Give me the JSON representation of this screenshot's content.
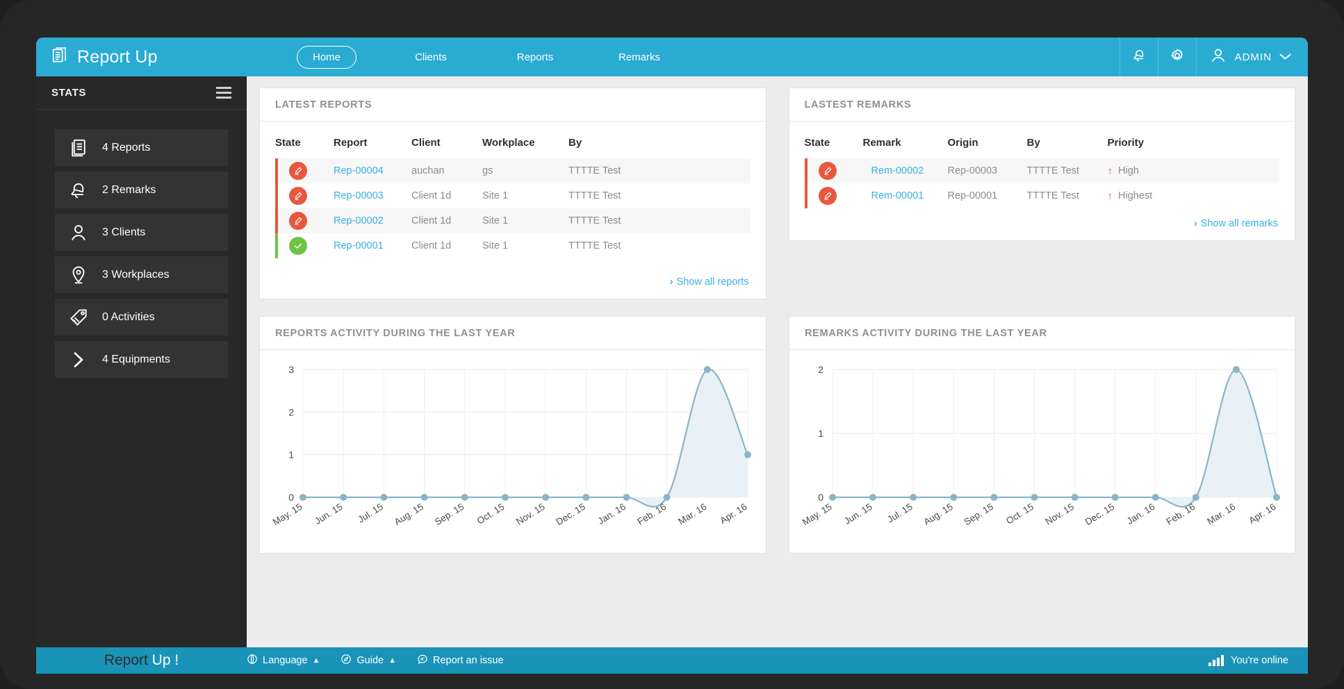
{
  "brand": {
    "title": "Report Up",
    "icon": "document-stack-icon"
  },
  "topnav": {
    "items": [
      {
        "label": "Home",
        "active": true
      },
      {
        "label": "Clients",
        "active": false
      },
      {
        "label": "Reports",
        "active": false
      },
      {
        "label": "Remarks",
        "active": false
      }
    ],
    "icons": [
      {
        "name": "bell-icon"
      },
      {
        "name": "gear-icon"
      }
    ],
    "user": {
      "label": "ADMIN",
      "avatar_icon": "user-icon",
      "caret": "▼"
    }
  },
  "sidebar": {
    "title": "STATS",
    "menu_icon": "hamburger-icon",
    "items": [
      {
        "label": "4 Reports",
        "icon": "document-stack-icon"
      },
      {
        "label": "2 Remarks",
        "icon": "bell-icon"
      },
      {
        "label": "3 Clients",
        "icon": "user-icon"
      },
      {
        "label": "3 Workplaces",
        "icon": "map-pin-icon"
      },
      {
        "label": "0 Activities",
        "icon": "tag-icon"
      },
      {
        "label": "4 Equipments",
        "icon": "chevron-right-icon"
      }
    ]
  },
  "latest_reports": {
    "title": "LATEST REPORTS",
    "columns": [
      "State",
      "Report",
      "Client",
      "Workplace",
      "By"
    ],
    "rows": [
      {
        "state": "pending",
        "report": "Rep-00004",
        "client": "auchan",
        "workplace": "gs",
        "by": "TTTTE Test"
      },
      {
        "state": "pending",
        "report": "Rep-00003",
        "client": "Client 1d",
        "workplace": "Site 1",
        "by": "TTTTE Test"
      },
      {
        "state": "pending",
        "report": "Rep-00002",
        "client": "Client 1d",
        "workplace": "Site 1",
        "by": "TTTTE Test"
      },
      {
        "state": "done",
        "report": "Rep-00001",
        "client": "Client 1d",
        "workplace": "Site 1",
        "by": "TTTTE Test"
      }
    ],
    "show_all": "Show all reports"
  },
  "latest_remarks": {
    "title": "LASTEST REMARKS",
    "columns": [
      "State",
      "Remark",
      "Origin",
      "By",
      "Priority"
    ],
    "rows": [
      {
        "state": "pending",
        "remark": "Rem-00002",
        "origin": "Rep-00003",
        "by": "TTTTE Test",
        "priority": "High"
      },
      {
        "state": "pending",
        "remark": "Rem-00001",
        "origin": "Rep-00001",
        "by": "TTTTE Test",
        "priority": "Highest"
      }
    ],
    "show_all": "Show all remarks"
  },
  "reports_chart_title": "REPORTS ACTIVITY DURING THE LAST YEAR",
  "remarks_chart_title": "REMARKS ACTIVITY DURING THE LAST YEAR",
  "footer": {
    "brand_left": "Report ",
    "brand_right": "Up !",
    "links": [
      {
        "label": "Language",
        "icon": "globe-icon",
        "caret": "▲"
      },
      {
        "label": "Guide",
        "icon": "compass-icon",
        "caret": "▲"
      },
      {
        "label": "Report an issue",
        "icon": "speech-bubble-icon",
        "caret": ""
      }
    ],
    "status": "You're online",
    "status_icon": "signal-bars-icon"
  },
  "colors": {
    "accent": "#29abd2",
    "accent_dark": "#1a93b8",
    "sidebar_bg": "#282828",
    "sidebar_item": "#333333",
    "page_bg": "#ececec",
    "link": "#38b0e3",
    "pending": "#e8573f",
    "done": "#6fc243",
    "chart_line": "#8ab4c8",
    "chart_fill": "#e8f1f5"
  },
  "chart_data": [
    {
      "type": "area",
      "title": "REPORTS ACTIVITY DURING THE LAST YEAR",
      "categories": [
        "May. 15",
        "Jun. 15",
        "Jul. 15",
        "Aug. 15",
        "Sep. 15",
        "Oct. 15",
        "Nov. 15",
        "Dec. 15",
        "Jan. 16",
        "Feb. 16",
        "Mar. 16",
        "Apr. 16"
      ],
      "values": [
        0,
        0,
        0,
        0,
        0,
        0,
        0,
        0,
        0,
        0,
        3,
        1
      ],
      "yticks": [
        0,
        1,
        2,
        3
      ],
      "ylim": [
        0,
        3
      ],
      "xlabel": "",
      "ylabel": "",
      "grid": true,
      "legend": "none"
    },
    {
      "type": "area",
      "title": "REMARKS ACTIVITY DURING THE LAST YEAR",
      "categories": [
        "May. 15",
        "Jun. 15",
        "Jul. 15",
        "Aug. 15",
        "Sep. 15",
        "Oct. 15",
        "Nov. 15",
        "Dec. 15",
        "Jan. 16",
        "Feb. 16",
        "Mar. 16",
        "Apr. 16"
      ],
      "values": [
        0,
        0,
        0,
        0,
        0,
        0,
        0,
        0,
        0,
        0,
        2,
        0
      ],
      "yticks": [
        0,
        1,
        2
      ],
      "ylim": [
        0,
        2
      ],
      "xlabel": "",
      "ylabel": "",
      "grid": true,
      "legend": "none"
    }
  ]
}
